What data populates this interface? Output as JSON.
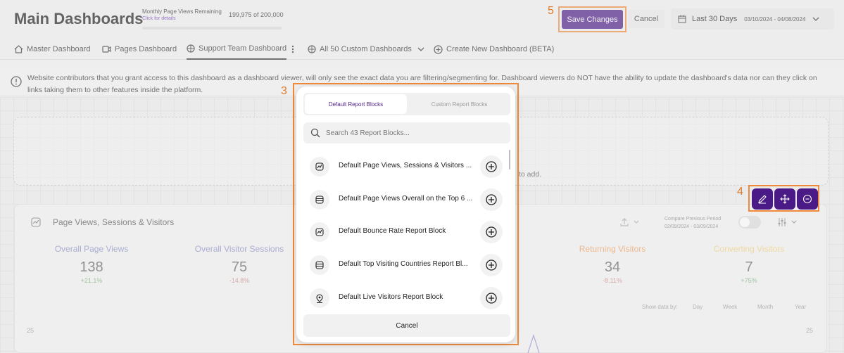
{
  "header": {
    "title": "Main Dashboards",
    "page_views_label": "Monthly Page Views Remaining",
    "page_views_link": "Click for details",
    "page_views_count": "199,975 of 200,000",
    "page_views_fraction_remaining": 0.9999,
    "save_label": "Save Changes",
    "cancel_label": "Cancel",
    "date_label": "Last 30 Days",
    "date_range": "03/10/2024 - 04/08/2024"
  },
  "tabs": [
    {
      "label": "Master Dashboard",
      "icon": "home-icon"
    },
    {
      "label": "Pages Dashboard",
      "icon": "video-icon"
    },
    {
      "label": "Support Team Dashboard",
      "icon": "globe-icon"
    },
    {
      "label": "All 50 Custom Dashboards",
      "icon": "globe-icon"
    },
    {
      "label": "Create New Dashboard (BETA)",
      "icon": "plus-circle-icon"
    }
  ],
  "notice": "Website contributors that you grant access to this dashboard as a dashboard viewer, will only see the exact data you are filtering/segmenting for. Dashboard viewers do NOT have the ability to update the dashboard's data nor can they click on links taking them to other features inside the platform.",
  "drop_zone_text": "to add.",
  "annotations": {
    "save": "5",
    "modal": "3",
    "actions": "4"
  },
  "card": {
    "title": "Page Views, Sessions & Visitors",
    "compare_label": "Compare Previous Period",
    "compare_range": "02/09/2024 - 03/09/2024",
    "stats": [
      {
        "label": "Overall Page Views",
        "value": "138",
        "change": "+21.1%",
        "color": "#5a9a5a"
      },
      {
        "label": "Overall Visitor Sessions",
        "value": "75",
        "change": "-14.8%",
        "color": "#c0504d"
      },
      {
        "label": "Returning Visitors",
        "value": "34",
        "change": "-8.11%",
        "color": "#c0504d"
      },
      {
        "label": "Converting Visitors",
        "value": "7",
        "change": "+75%",
        "color": "#5a9a5a"
      }
    ],
    "show_by_label": "Show data by:",
    "show_by_options": [
      "Day",
      "Week",
      "Month",
      "Year"
    ],
    "axis_top": "25"
  },
  "modal": {
    "tab_default": "Default Report Blocks",
    "tab_custom": "Custom Report Blocks",
    "search_placeholder": "Search 43 Report Blocks...",
    "items": [
      {
        "label": "Default Page Views, Sessions & Visitors ...",
        "icon": "line-chart-icon"
      },
      {
        "label": "Default Page Views Overall on the Top 6 ...",
        "icon": "table-icon"
      },
      {
        "label": "Default Bounce Rate Report Block",
        "icon": "line-chart-icon"
      },
      {
        "label": "Default Top Visiting Countries Report Bl...",
        "icon": "table-icon"
      },
      {
        "label": "Default Live Visitors Report Block",
        "icon": "map-pin-icon"
      }
    ],
    "cancel_label": "Cancel"
  }
}
